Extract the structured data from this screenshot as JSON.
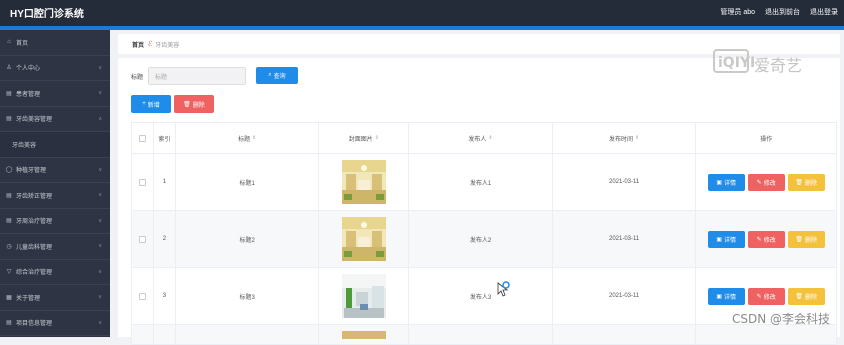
{
  "app": {
    "title": "HY口腔门诊系统"
  },
  "topnav": {
    "user": "管理员 abo",
    "back_to_admin": "退出到前台",
    "logout": "退出登录"
  },
  "sidebar": {
    "items": [
      {
        "label": "首页",
        "icon": "home-icon"
      },
      {
        "label": "个人中心",
        "icon": "user-icon"
      },
      {
        "label": "患者管理",
        "icon": "list-icon"
      },
      {
        "label": "牙齿美容管理",
        "icon": "list-icon"
      },
      {
        "label": "牙齿美容",
        "icon": ""
      },
      {
        "label": "种植牙管理",
        "icon": "circle-icon"
      },
      {
        "label": "牙齿矫正管理",
        "icon": "list-icon"
      },
      {
        "label": "牙周治疗管理",
        "icon": "list-icon"
      },
      {
        "label": "儿童齿科管理",
        "icon": "clock-icon"
      },
      {
        "label": "综合治疗管理",
        "icon": "funnel-icon"
      },
      {
        "label": "关于管理",
        "icon": "grid-icon"
      },
      {
        "label": "项目信息管理",
        "icon": "list-icon"
      }
    ]
  },
  "breadcrumb": {
    "home": "首页",
    "current": "牙齿美容"
  },
  "search": {
    "label": "标题",
    "placeholder": "标题",
    "button": "查询"
  },
  "actions": {
    "add": "新增",
    "delete": "删除"
  },
  "table": {
    "headers": {
      "index": "索引",
      "title": "标题",
      "cover": "封面图片",
      "publisher": "发布人",
      "time": "发布时间",
      "ops": "操作"
    },
    "rows": [
      {
        "index": "1",
        "title": "标题1",
        "publisher": "发布人1",
        "time": "2021-03-11"
      },
      {
        "index": "2",
        "title": "标题2",
        "publisher": "发布人2",
        "time": "2021-03-11"
      },
      {
        "index": "3",
        "title": "标题3",
        "publisher": "发布人3",
        "time": "2021-03-11"
      }
    ],
    "op_labels": {
      "detail": "详情",
      "edit": "修改",
      "remove": "删除"
    }
  },
  "watermark": {
    "iqiyi": "爱奇艺",
    "csdn": "CSDN @李会科技"
  },
  "colors": {
    "topbar": "#252c39",
    "sidebar": "#2e3444",
    "accent": "#1e8ce8",
    "danger": "#f06262",
    "warning": "#f3c13a"
  }
}
